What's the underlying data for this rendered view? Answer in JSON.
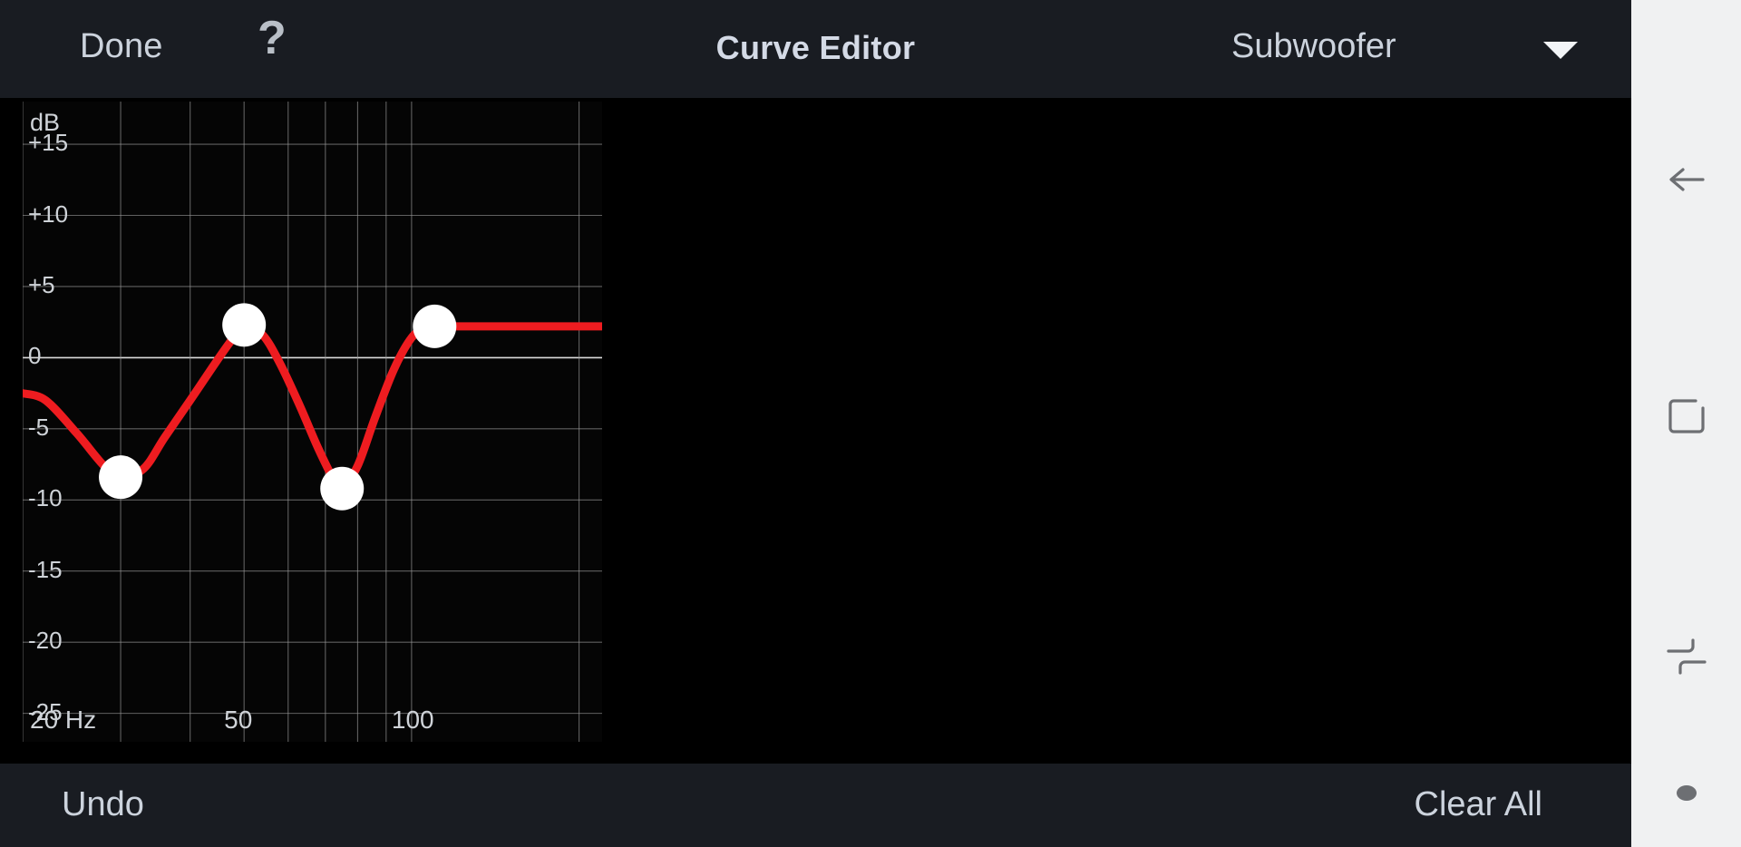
{
  "topbar": {
    "done_label": "Done",
    "help_icon_glyph": "?",
    "title": "Curve Editor",
    "channel_value": "Subwoofer"
  },
  "bottombar": {
    "undo_label": "Undo",
    "clear_all_label": "Clear All"
  },
  "navrail": {
    "back_name": "back-arrow-icon",
    "recents_name": "recents-square-icon",
    "split_name": "split-screen-icon",
    "dot_name": "dot-indicator-icon"
  },
  "chart_data": {
    "type": "line",
    "title": "Curve Editor",
    "xlabel": "",
    "ylabel": "dB",
    "unit_label": "dB",
    "xscale": "log",
    "xlim": [
      20,
      220
    ],
    "ylim": [
      -27,
      18
    ],
    "grid": true,
    "legend": "none",
    "accent_color": "#ee1c20",
    "handle_color": "#ffffff",
    "grid_color": "#9a9a9a",
    "y_ticks": [
      15,
      10,
      5,
      0,
      -5,
      -10,
      -15,
      -20,
      -25
    ],
    "y_tick_labels": [
      "+15",
      "+10",
      "+5",
      "0",
      "-5",
      "-10",
      "-15",
      "-20",
      "-25"
    ],
    "x_ticks": [
      20,
      50,
      100
    ],
    "x_tick_labels": [
      "20 Hz",
      "50",
      "100"
    ],
    "x_gridlines": [
      20,
      30,
      40,
      50,
      60,
      70,
      80,
      90,
      100,
      200
    ],
    "control_points": [
      {
        "freq": 30,
        "db": -8.4
      },
      {
        "freq": 50,
        "db": 2.3
      },
      {
        "freq": 75,
        "db": -9.2
      },
      {
        "freq": 110,
        "db": 2.2
      }
    ],
    "curve_points": [
      {
        "freq": 20,
        "db": -2.5
      },
      {
        "freq": 22,
        "db": -3.0
      },
      {
        "freq": 25,
        "db": -5.3
      },
      {
        "freq": 28,
        "db": -7.6
      },
      {
        "freq": 30,
        "db": -8.4
      },
      {
        "freq": 33,
        "db": -7.8
      },
      {
        "freq": 36,
        "db": -5.6
      },
      {
        "freq": 40,
        "db": -3.0
      },
      {
        "freq": 44,
        "db": -0.6
      },
      {
        "freq": 47,
        "db": 1.0
      },
      {
        "freq": 50,
        "db": 2.3
      },
      {
        "freq": 54,
        "db": 1.6
      },
      {
        "freq": 58,
        "db": -0.4
      },
      {
        "freq": 63,
        "db": -3.4
      },
      {
        "freq": 68,
        "db": -6.4
      },
      {
        "freq": 73,
        "db": -8.8
      },
      {
        "freq": 75,
        "db": -9.2
      },
      {
        "freq": 80,
        "db": -7.6
      },
      {
        "freq": 86,
        "db": -4.2
      },
      {
        "freq": 93,
        "db": -0.8
      },
      {
        "freq": 100,
        "db": 1.4
      },
      {
        "freq": 106,
        "db": 2.1
      },
      {
        "freq": 110,
        "db": 2.2
      },
      {
        "freq": 150,
        "db": 2.2
      },
      {
        "freq": 220,
        "db": 2.2
      }
    ]
  }
}
